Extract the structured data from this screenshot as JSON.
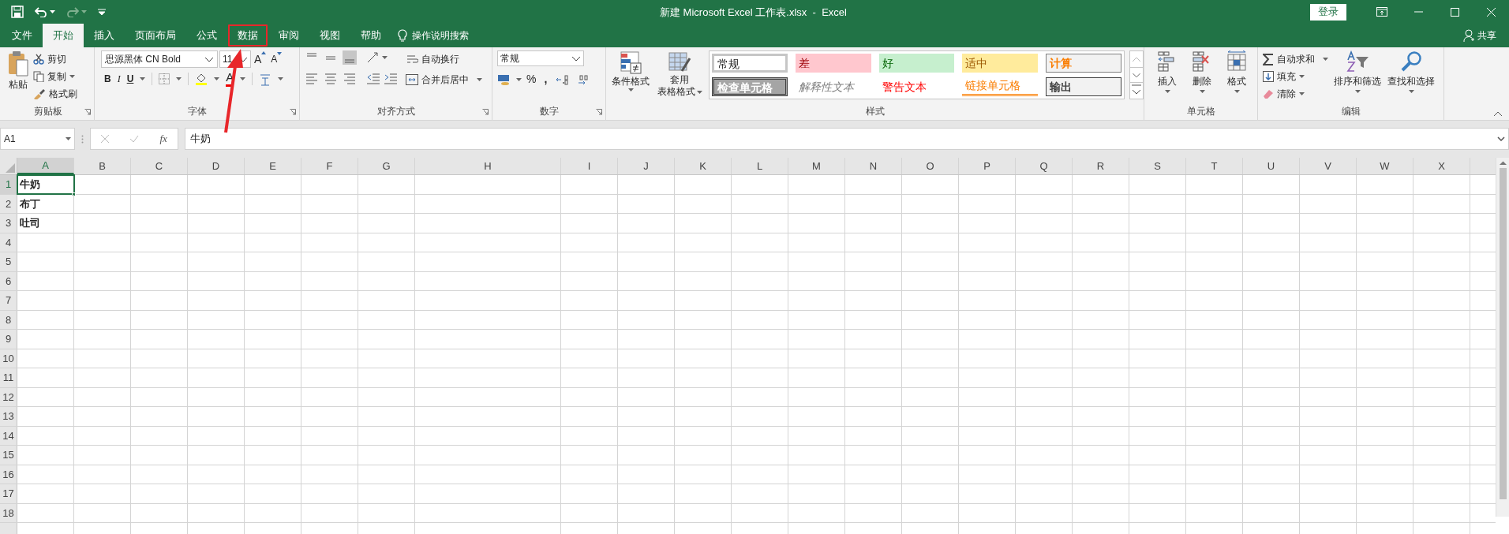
{
  "window": {
    "title": "新建 Microsoft Excel 工作表.xlsx  -  Excel",
    "sign_in": "登录"
  },
  "tabs": [
    {
      "label": "文件",
      "selected": false,
      "highlighted": false
    },
    {
      "label": "开始",
      "selected": true,
      "highlighted": false
    },
    {
      "label": "插入",
      "selected": false,
      "highlighted": false
    },
    {
      "label": "页面布局",
      "selected": false,
      "highlighted": false
    },
    {
      "label": "公式",
      "selected": false,
      "highlighted": false
    },
    {
      "label": "数据",
      "selected": false,
      "highlighted": true
    },
    {
      "label": "审阅",
      "selected": false,
      "highlighted": false
    },
    {
      "label": "视图",
      "selected": false,
      "highlighted": false
    },
    {
      "label": "帮助",
      "selected": false,
      "highlighted": false
    }
  ],
  "tell_me": "操作说明搜索",
  "share": "共享",
  "ribbon": {
    "clipboard": {
      "paste": "粘贴",
      "cut": "剪切",
      "copy": "复制",
      "format_painter": "格式刷",
      "label": "剪贴板"
    },
    "font": {
      "font_name": "思源黑体 CN Bold",
      "font_size": "11",
      "grow": "A",
      "shrink": "A",
      "bold": "B",
      "italic": "I",
      "underline": "U",
      "font_color": "A",
      "label": "字体"
    },
    "alignment": {
      "wrap_text": "自动换行",
      "merge_center": "合并后居中",
      "label": "对齐方式"
    },
    "number": {
      "format": "常规",
      "percent": "%",
      "comma": ",",
      "label": "数字"
    },
    "styles": {
      "conditional_formatting": "条件格式",
      "format_as_table": [
        "套用",
        "表格格式"
      ],
      "label": "样式",
      "cell_styles": [
        {
          "text": "常规",
          "kind": "normal"
        },
        {
          "text": "差",
          "kind": "bad"
        },
        {
          "text": "好",
          "kind": "good"
        },
        {
          "text": "适中",
          "kind": "neutral"
        },
        {
          "text": "计算",
          "kind": "calculation"
        },
        {
          "text": "检查单元格",
          "kind": "check"
        },
        {
          "text": "解释性文本",
          "kind": "explanatory"
        },
        {
          "text": "警告文本",
          "kind": "warning"
        },
        {
          "text": "链接单元格",
          "kind": "linked"
        },
        {
          "text": "输出",
          "kind": "output"
        }
      ]
    },
    "cells": {
      "items": [
        "插入",
        "删除",
        "格式"
      ],
      "label": "单元格"
    },
    "editing": {
      "autosum": "自动求和",
      "fill": "填充",
      "clear": "清除",
      "sort_filter": "排序和筛选",
      "find_select": "查找和选择",
      "label": "编辑"
    }
  },
  "formula_bar": {
    "name_box": "A1",
    "function_label": "fx",
    "value": "牛奶"
  },
  "grid": {
    "columns": [
      {
        "label": "A",
        "selected": true
      },
      {
        "label": "B",
        "selected": false
      },
      {
        "label": "C",
        "selected": false
      },
      {
        "label": "D",
        "selected": false
      },
      {
        "label": "E",
        "selected": false
      },
      {
        "label": "F",
        "selected": false
      },
      {
        "label": "G",
        "selected": false
      },
      {
        "label": "H",
        "selected": false
      },
      {
        "label": "I",
        "selected": false
      },
      {
        "label": "J",
        "selected": false
      },
      {
        "label": "K",
        "selected": false
      },
      {
        "label": "L",
        "selected": false
      },
      {
        "label": "M",
        "selected": false
      },
      {
        "label": "N",
        "selected": false
      },
      {
        "label": "O",
        "selected": false
      },
      {
        "label": "P",
        "selected": false
      },
      {
        "label": "Q",
        "selected": false
      },
      {
        "label": "R",
        "selected": false
      },
      {
        "label": "S",
        "selected": false
      },
      {
        "label": "T",
        "selected": false
      },
      {
        "label": "U",
        "selected": false
      },
      {
        "label": "V",
        "selected": false
      },
      {
        "label": "W",
        "selected": false
      },
      {
        "label": "X",
        "selected": false
      }
    ],
    "rows": [
      {
        "label": "1",
        "selected": true,
        "cells": [
          "牛奶"
        ]
      },
      {
        "label": "2",
        "selected": false,
        "cells": [
          "布丁"
        ]
      },
      {
        "label": "3",
        "selected": false,
        "cells": [
          "吐司"
        ]
      },
      {
        "label": "4",
        "selected": false
      },
      {
        "label": "5",
        "selected": false
      },
      {
        "label": "6",
        "selected": false
      },
      {
        "label": "7",
        "selected": false
      },
      {
        "label": "8",
        "selected": false
      },
      {
        "label": "9",
        "selected": false
      },
      {
        "label": "10",
        "selected": false
      },
      {
        "label": "11",
        "selected": false
      },
      {
        "label": "12",
        "selected": false
      },
      {
        "label": "13",
        "selected": false
      },
      {
        "label": "14",
        "selected": false
      },
      {
        "label": "15",
        "selected": false
      },
      {
        "label": "16",
        "selected": false
      },
      {
        "label": "17",
        "selected": false
      },
      {
        "label": "18",
        "selected": false
      }
    ]
  }
}
